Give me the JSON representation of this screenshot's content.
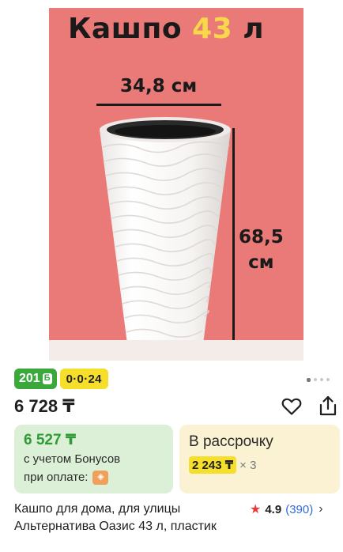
{
  "photo": {
    "title_prefix": "Кашпо",
    "title_volume": "43",
    "title_unit": "л",
    "width_label": "34,8 см",
    "height_value": "68,5",
    "height_unit": "см",
    "background_color": "#ea7a78",
    "carousel_pages": 4,
    "carousel_active": 0
  },
  "badges": {
    "bonus_value": "201",
    "bonus_icon": "Б",
    "installment_plan": "0·0·24"
  },
  "price": {
    "value": "6 728 ₸",
    "favorite_icon": "heart-icon",
    "share_icon": "share-icon"
  },
  "bonus_card": {
    "price": "6 527 ₸",
    "line1": "с учетом Бонусов",
    "line2": "при оплате:",
    "logo_icon": "kaspi-logo-icon"
  },
  "credit_card": {
    "title": "В рассрочку",
    "monthly": "2 243 ₸",
    "multiplier": "× 3"
  },
  "product": {
    "title": "Кашпо для дома, для улицы Альтернатива Оазис 43 л, пластик",
    "rating": "4.9",
    "reviews": "(390)",
    "star_icon": "star-icon",
    "chevron_icon": "chevron-right-icon"
  },
  "colors": {
    "bonus_green": "#3aa83a",
    "installment_yellow": "#f6df2a",
    "link_blue": "#2f6bd8",
    "star_red": "#e53c3c"
  }
}
